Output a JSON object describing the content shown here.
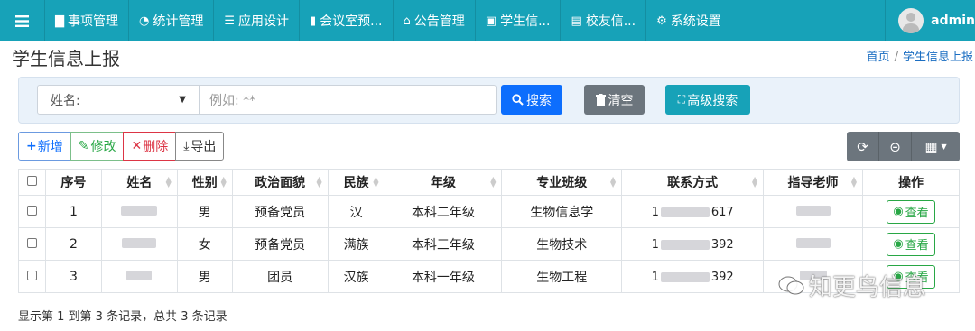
{
  "nav": {
    "items": [
      {
        "icon": "▇",
        "label": "事项管理"
      },
      {
        "icon": "◔",
        "label": "统计管理"
      },
      {
        "icon": "☰",
        "label": "应用设计"
      },
      {
        "icon": "▮",
        "label": "会议室预..."
      },
      {
        "icon": "⌂",
        "label": "公告管理"
      },
      {
        "icon": "▣",
        "label": "学生信..."
      },
      {
        "icon": "▤",
        "label": "校友信..."
      },
      {
        "icon": "⚙",
        "label": "系统设置"
      }
    ],
    "user": "admin"
  },
  "page": {
    "title": "学生信息上报",
    "breadcrumb_home": "首页",
    "breadcrumb_current": "学生信息上报"
  },
  "search": {
    "field_selected": "姓名:",
    "placeholder": "例如: **",
    "search_label": "搜索",
    "clear_label": "清空",
    "advanced_label": "高级搜索"
  },
  "toolbar": {
    "add": "新增",
    "edit": "修改",
    "delete": "删除",
    "export": "导出"
  },
  "table": {
    "headers": [
      "序号",
      "姓名",
      "性别",
      "政治面貌",
      "民族",
      "年级",
      "专业班级",
      "联系方式",
      "指导老师",
      "操作"
    ],
    "rows": [
      {
        "no": "1",
        "gender": "男",
        "political": "预备党员",
        "ethnicity": "汉",
        "grade": "本科二年级",
        "major": "生物信息学",
        "phone_prefix": "1",
        "phone_suffix": "617",
        "action": "查看"
      },
      {
        "no": "2",
        "gender": "女",
        "political": "预备党员",
        "ethnicity": "满族",
        "grade": "本科三年级",
        "major": "生物技术",
        "phone_prefix": "1",
        "phone_suffix": "392",
        "action": "查看"
      },
      {
        "no": "3",
        "gender": "男",
        "political": "团员",
        "ethnicity": "汉族",
        "grade": "本科一年级",
        "major": "生物工程",
        "phone_prefix": "1",
        "phone_suffix": "392",
        "action": "查看"
      }
    ]
  },
  "footer": {
    "summary": "显示第 1 到第 3 条记录，总共 3 条记录"
  },
  "watermark": "知更鸟信息",
  "colors": {
    "nav_bg": "#17a2b8",
    "primary": "#0d6efd",
    "secondary": "#6c757d",
    "success": "#28a745",
    "danger": "#dc3545"
  }
}
